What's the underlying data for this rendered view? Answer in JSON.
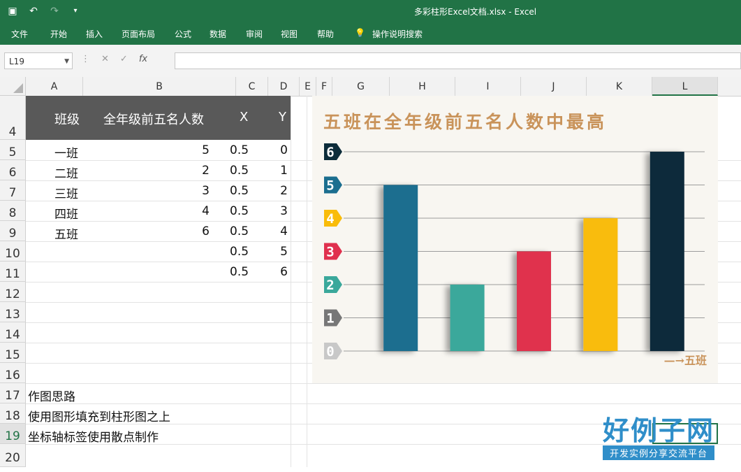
{
  "window": {
    "title": "多彩柱形Excel文档.xlsx  -  Excel"
  },
  "ribbon": {
    "tabs": [
      "文件",
      "开始",
      "插入",
      "页面布局",
      "公式",
      "数据",
      "审阅",
      "视图",
      "帮助"
    ],
    "tellme": "操作说明搜索"
  },
  "formula_bar": {
    "name_box": "L19",
    "fx": "fx",
    "content": ""
  },
  "columns": [
    "A",
    "B",
    "C",
    "D",
    "E",
    "F",
    "G",
    "H",
    "I",
    "J",
    "K",
    "L"
  ],
  "rows": [
    "4",
    "5",
    "6",
    "7",
    "8",
    "9",
    "10",
    "11",
    "12",
    "13",
    "14",
    "15",
    "16",
    "17",
    "18",
    "19",
    "20"
  ],
  "selected_row": "19",
  "table": {
    "headers": {
      "a": "班级",
      "b": "全年级前五名人数",
      "c": "X",
      "d": "Y"
    },
    "rows": [
      {
        "a": "一班",
        "b": "5",
        "c": "0.5",
        "d": "0"
      },
      {
        "a": "二班",
        "b": "2",
        "c": "0.5",
        "d": "1"
      },
      {
        "a": "三班",
        "b": "3",
        "c": "0.5",
        "d": "2"
      },
      {
        "a": "四班",
        "b": "4",
        "c": "0.5",
        "d": "3"
      },
      {
        "a": "五班",
        "b": "6",
        "c": "0.5",
        "d": "4"
      },
      {
        "a": "",
        "b": "",
        "c": "0.5",
        "d": "5"
      },
      {
        "a": "",
        "b": "",
        "c": "0.5",
        "d": "6"
      }
    ]
  },
  "notes": [
    "作图思路",
    "使用图形填充到柱形图之上",
    "坐标轴标签使用散点制作"
  ],
  "chart_data": {
    "type": "bar",
    "title": "五班在全年级前五名人数中最高",
    "categories": [
      "一班",
      "二班",
      "三班",
      "四班",
      "五班"
    ],
    "values": [
      5,
      2,
      3,
      4,
      6
    ],
    "colors": [
      "#1b6e8f",
      "#3aa89b",
      "#e0304e",
      "#f9bc0a",
      "#0c2c3a"
    ],
    "ylim": [
      0,
      6
    ],
    "y_ticks": [
      "0",
      "1",
      "2",
      "3",
      "4",
      "5",
      "6"
    ],
    "tick_colors": [
      "#c8c8c8",
      "#777777",
      "#3aa89b",
      "#e0304e",
      "#f9bc0a",
      "#1b6e8f",
      "#0c2c3a"
    ],
    "annotation": "—→五班",
    "grid": true
  },
  "watermark": {
    "logo": "好例子网",
    "tagline": "开发实例分享交流平台"
  }
}
